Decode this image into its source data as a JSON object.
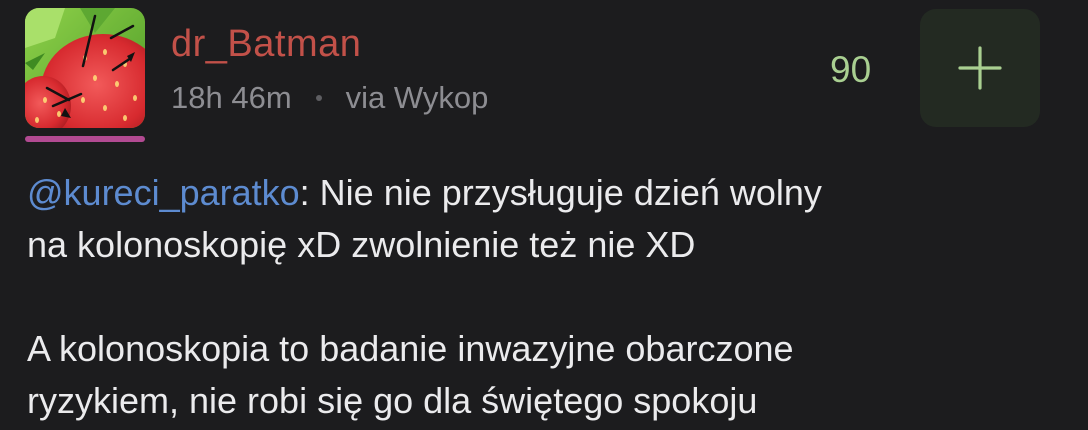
{
  "entry": {
    "author": {
      "username": "dr_Batman",
      "avatar_icon": "strawberry-avatar",
      "username_color": "#c25149",
      "underline_color": "#b24a92"
    },
    "meta": {
      "time_ago": "18h 46m",
      "source": "via Wykop"
    },
    "votes": {
      "count": "90",
      "plus_icon": "plus-icon",
      "color": "#a9cf91"
    },
    "content": {
      "mention": "@kureci_paratko",
      "line1_rest": ": Nie nie przysługuje dzień wolny",
      "line2": "na kolonoskopię xD zwolnienie też nie XD",
      "paragraph2_line1": "A kolonoskopia to badanie inwazyjne obarczone",
      "paragraph2_line2": "ryzykiem, nie robi się go dla świętego spokoju"
    }
  }
}
